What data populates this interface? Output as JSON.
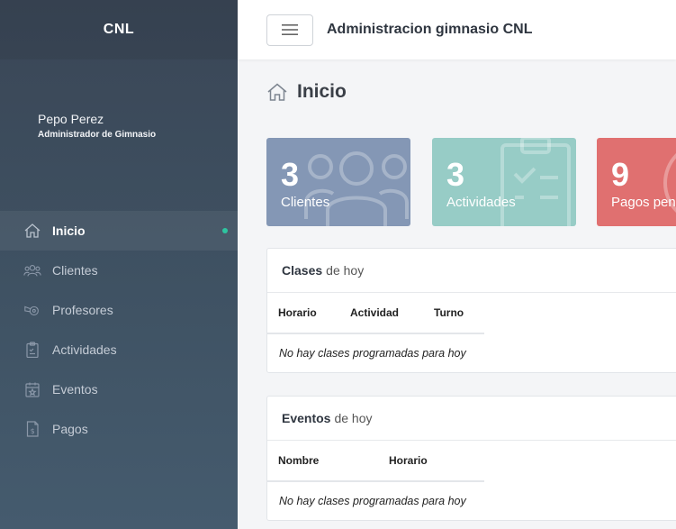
{
  "sidebar": {
    "brand": "CNL",
    "user": {
      "name": "Pepo Perez",
      "role": "Administrador de Gimnasio"
    },
    "items": [
      {
        "label": "Inicio",
        "icon": "home-icon",
        "active": true
      },
      {
        "label": "Clientes",
        "icon": "users-icon"
      },
      {
        "label": "Profesores",
        "icon": "whistle-icon"
      },
      {
        "label": "Actividades",
        "icon": "clipboard-icon"
      },
      {
        "label": "Eventos",
        "icon": "calendar-star-icon"
      },
      {
        "label": "Pagos",
        "icon": "receipt-icon"
      }
    ]
  },
  "header": {
    "title": "Administracion gimnasio CNL",
    "menu_icon": "hamburger-icon"
  },
  "page": {
    "title": "Inicio",
    "icon": "home-icon"
  },
  "cards": [
    {
      "value": "3",
      "label": "Clientes",
      "color": "#8497b5",
      "icon": "users-icon"
    },
    {
      "value": "3",
      "label": "Actividades",
      "color": "#97ccc6",
      "icon": "clipboard-icon"
    },
    {
      "value": "9",
      "label": "Pagos pendientes",
      "color": "#e07070",
      "icon": "clock-icon"
    }
  ],
  "classes_panel": {
    "title_strong": "Clases",
    "title_soft": "de hoy",
    "columns": [
      "Horario",
      "Actividad",
      "Turno"
    ],
    "empty_text": "No hay clases programadas para hoy"
  },
  "events_panel": {
    "title_strong": "Eventos",
    "title_soft": "de hoy",
    "columns": [
      "Nombre",
      "Horario"
    ],
    "empty_text": "No hay clases programadas para hoy"
  },
  "colors": {
    "accent_dot": "#2ec4a0",
    "sidebar_top": "#3a4656",
    "sidebar_bottom": "#455b6e"
  }
}
